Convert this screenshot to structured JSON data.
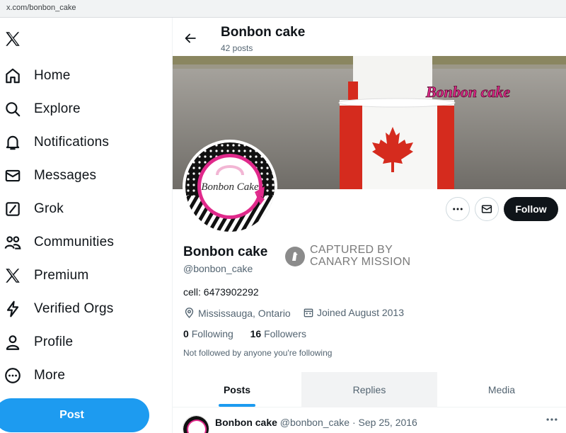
{
  "browser": {
    "url": "x.com/bonbon_cake"
  },
  "sidebar": {
    "items": [
      {
        "label": "Home",
        "icon": "home-icon"
      },
      {
        "label": "Explore",
        "icon": "search-icon"
      },
      {
        "label": "Notifications",
        "icon": "bell-icon"
      },
      {
        "label": "Messages",
        "icon": "envelope-icon"
      },
      {
        "label": "Grok",
        "icon": "grok-icon"
      },
      {
        "label": "Communities",
        "icon": "communities-icon"
      },
      {
        "label": "Premium",
        "icon": "x-logo-icon"
      },
      {
        "label": "Verified Orgs",
        "icon": "lightning-icon"
      },
      {
        "label": "Profile",
        "icon": "person-icon"
      },
      {
        "label": "More",
        "icon": "more-circle-icon"
      }
    ],
    "post_label": "Post"
  },
  "header": {
    "name": "Bonbon cake",
    "posts": "42 posts"
  },
  "banner": {
    "brand_text": "Bonbon cake"
  },
  "avatar": {
    "text": "Bonbon Cake"
  },
  "actions": {
    "follow_label": "Follow"
  },
  "profile": {
    "name": "Bonbon cake",
    "handle": "@bonbon_cake",
    "bio": "cell: 6473902292",
    "location": "Mississauga, Ontario",
    "joined": "Joined August 2013",
    "following_count": "0",
    "following_label": "Following",
    "followers_count": "16",
    "followers_label": "Followers",
    "not_followed": "Not followed by anyone you're following"
  },
  "stamp": {
    "line1": "CAPTURED BY",
    "line2": "CANARY MISSION"
  },
  "tabs": [
    {
      "label": "Posts",
      "active": true
    },
    {
      "label": "Replies",
      "active": false
    },
    {
      "label": "Media",
      "active": false
    }
  ],
  "tweet": {
    "name": "Bonbon cake",
    "handle": "@bonbon_cake",
    "date": "· Sep 25, 2016"
  },
  "colors": {
    "accent": "#1d9bf0",
    "follow_bg": "#0f1419",
    "flag_red": "#d52b1e"
  }
}
